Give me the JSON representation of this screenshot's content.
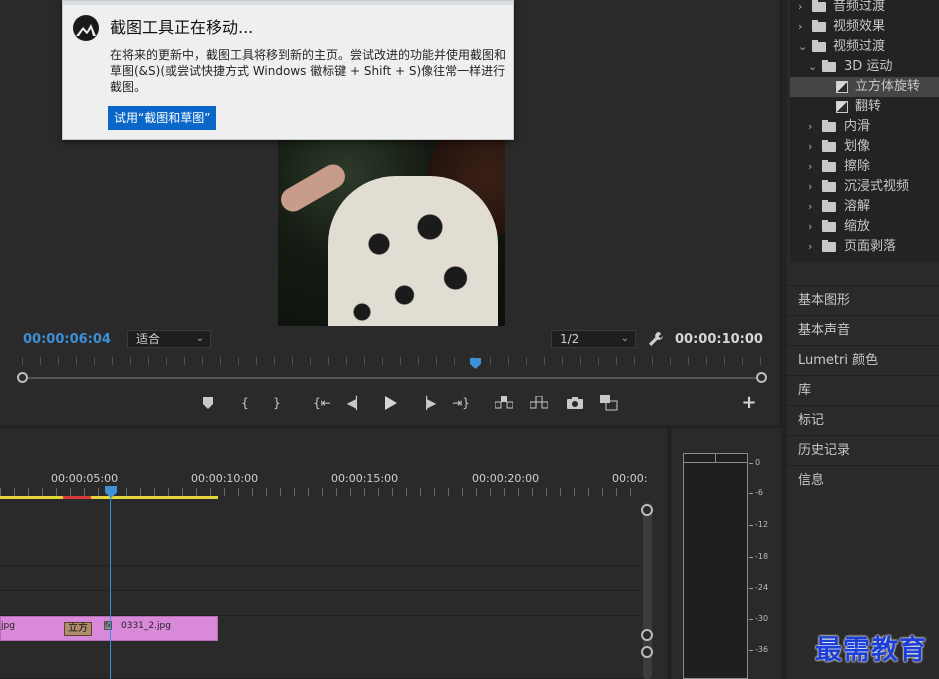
{
  "program_monitor": {
    "current_timecode": "00:00:06:04",
    "duration_timecode": "00:00:10:00",
    "fit_select": "适合",
    "resolution_select": "1/2",
    "transport_icons": [
      "marker-icon",
      "mark-in-icon",
      "mark-out-icon",
      "go-to-in-icon",
      "step-back-icon",
      "play-icon",
      "step-forward-icon",
      "go-to-out-icon",
      "lift-icon",
      "extract-icon",
      "export-frame-icon",
      "compare-view-icon"
    ],
    "add_button": "+"
  },
  "notification": {
    "title": "截图工具正在移动...",
    "body": "在将来的更新中，截图工具将移到新的主页。尝试改进的功能并使用截图和草图(&S)(或尝试快捷方式 Windows 徽标键 + Shift + S)像往常一样进行截图。",
    "button": "试用“截图和草图”"
  },
  "effects_tree": [
    {
      "label": "音频过渡",
      "level": 0,
      "expanded": false,
      "type": "folder"
    },
    {
      "label": "视频效果",
      "level": 0,
      "expanded": false,
      "type": "folder"
    },
    {
      "label": "视频过渡",
      "level": 0,
      "expanded": true,
      "type": "folder"
    },
    {
      "label": "3D 运动",
      "level": 1,
      "expanded": true,
      "type": "folder"
    },
    {
      "label": "立方体旋转",
      "level": 2,
      "type": "effect",
      "selected": true
    },
    {
      "label": "翻转",
      "level": 2,
      "type": "effect"
    },
    {
      "label": "内滑",
      "level": 1,
      "expanded": false,
      "type": "folder"
    },
    {
      "label": "划像",
      "level": 1,
      "expanded": false,
      "type": "folder"
    },
    {
      "label": "擦除",
      "level": 1,
      "expanded": false,
      "type": "folder"
    },
    {
      "label": "沉浸式视频",
      "level": 1,
      "expanded": false,
      "type": "folder"
    },
    {
      "label": "溶解",
      "level": 1,
      "expanded": false,
      "type": "folder"
    },
    {
      "label": "缩放",
      "level": 1,
      "expanded": false,
      "type": "folder"
    },
    {
      "label": "页面剥落",
      "level": 1,
      "expanded": false,
      "type": "folder"
    }
  ],
  "panels": [
    "基本图形",
    "基本声音",
    "Lumetri 颜色",
    "库",
    "标记",
    "历史记录",
    "信息"
  ],
  "timeline": {
    "ruler_labels": [
      "00:00:05:00",
      "00:00:10:00",
      "00:00:15:00",
      "00:00:20:00",
      "00:00:"
    ],
    "clip_left_name": "jpg",
    "clip_right_name": "0331_2.jpg",
    "transition_label": "立方",
    "fx_badge": "fx"
  },
  "audio_meter": {
    "db_labels": [
      "0",
      "-6",
      "-12",
      "-18",
      "-24",
      "-30",
      "-36"
    ]
  },
  "watermark": "最需教育",
  "colors": {
    "accent_blue": "#3d8fd6",
    "clip_pink": "#d989d9",
    "work_area_yellow": "#e6d53a",
    "watermark_blue": "#1e3fd6"
  }
}
